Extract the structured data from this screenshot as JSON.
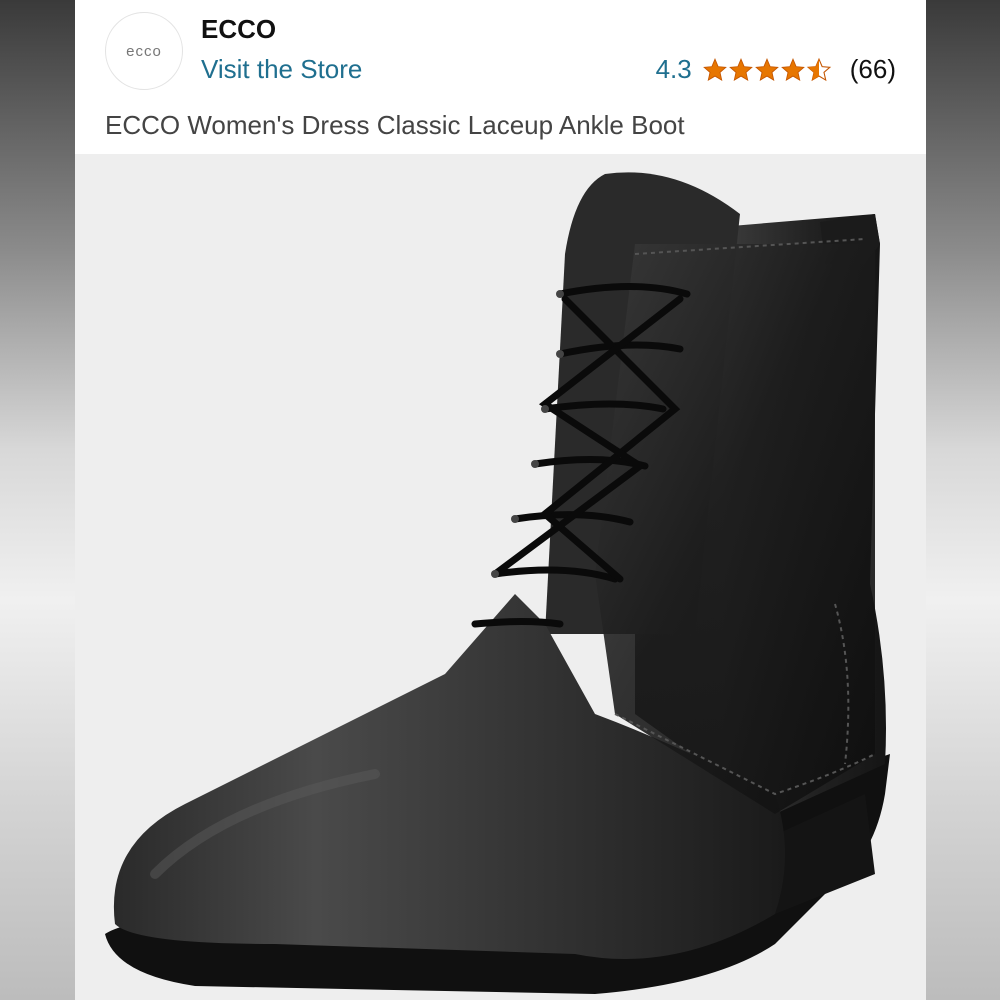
{
  "brand": {
    "logo_text": "ecco",
    "name": "ECCO",
    "store_link": "Visit the Store"
  },
  "rating": {
    "value": "4.3",
    "stars": 4.3,
    "count": "(66)",
    "star_color": "#e77600"
  },
  "product": {
    "title": "ECCO Women's Dress Classic Laceup Ankle Boot",
    "image": "product-photo-black-lace-up-ankle-boot"
  },
  "colors": {
    "link": "#1f6f8f",
    "image_background": "#eeeeee"
  }
}
